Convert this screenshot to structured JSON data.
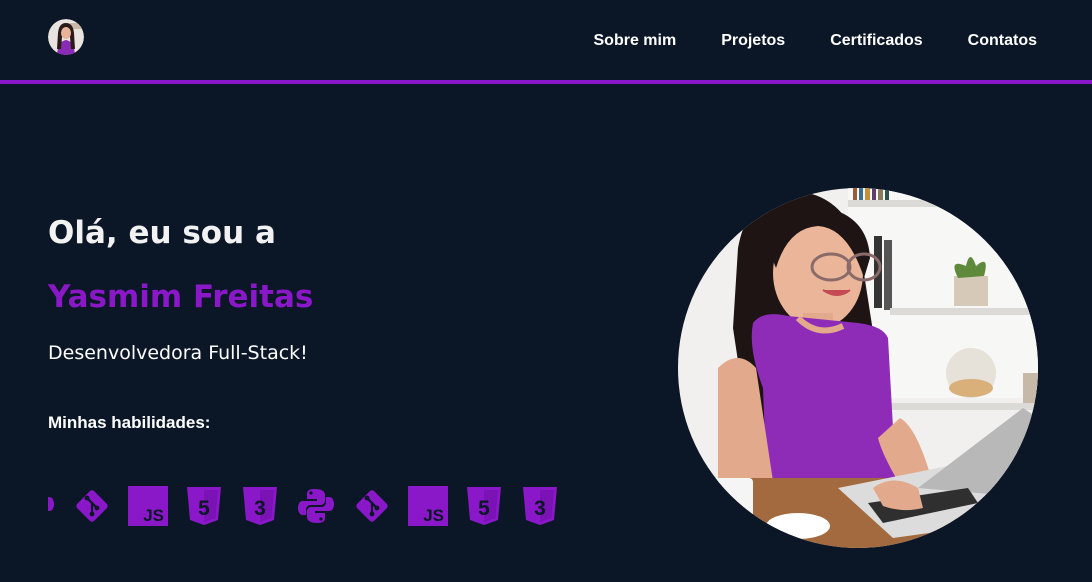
{
  "header": {
    "avatar_icon": "profile-photo",
    "nav": [
      {
        "label": "Sobre mim"
      },
      {
        "label": "Projetos"
      },
      {
        "label": "Certificados"
      },
      {
        "label": "Contatos"
      }
    ],
    "accent_border_color": "#8a18c8"
  },
  "hero": {
    "greeting": "Olá, eu sou a",
    "name": "Yasmim Freitas",
    "role": "Desenvolvedora Full-Stack!",
    "skills_title": "Minhas habilidades:",
    "skills": [
      {
        "icon": "python-icon"
      },
      {
        "icon": "git-icon"
      },
      {
        "icon": "javascript-icon",
        "text": "JS"
      },
      {
        "icon": "html5-icon",
        "text": "5"
      },
      {
        "icon": "css3-icon",
        "text": "3"
      },
      {
        "icon": "python-icon"
      },
      {
        "icon": "git-icon"
      },
      {
        "icon": "javascript-icon",
        "text": "JS"
      },
      {
        "icon": "html5-icon",
        "text": "5"
      },
      {
        "icon": "css3-icon",
        "text": "3"
      }
    ],
    "photo_icon": "profile-photo"
  },
  "colors": {
    "background": "#0b1727",
    "accent": "#8a18c8",
    "text": "#ffffff"
  }
}
